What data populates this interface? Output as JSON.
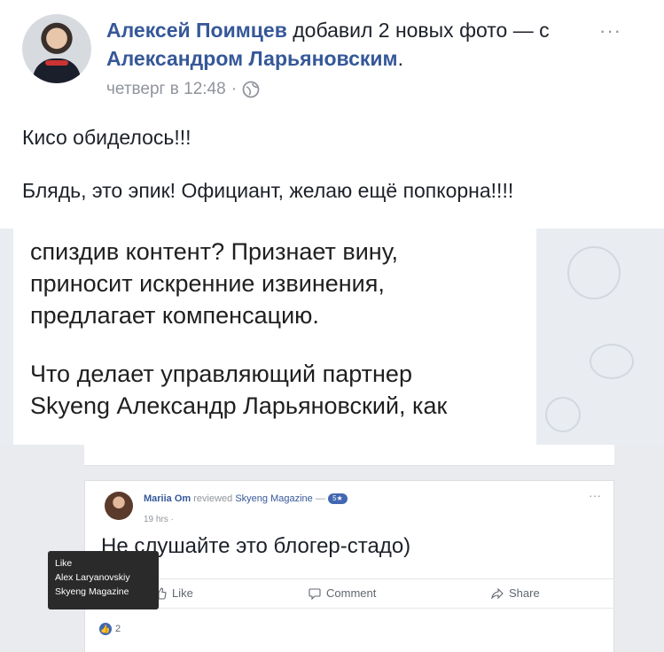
{
  "post": {
    "author": "Алексей Поимцев",
    "action_text": "добавил 2 новых фото — с",
    "tagged": "Александром Ларьяновским",
    "period": ".",
    "timestamp": "четверг в 12:48",
    "separator": "·",
    "menu": "···",
    "text_line1": "Кисо обиделось!!!",
    "text_line2": "Блядь, это эпик! Официант, желаю ещё попкорна!!!!"
  },
  "screenshot1": {
    "lines": [
      "спиздив контент? Признает вину,",
      "приносит искренние извинения,",
      "предлагает компенсацию.",
      "Что делает управляющий партнер",
      "Skyeng Александр Ларьяновский, как"
    ]
  },
  "screenshot2": {
    "author": "Mariia Om",
    "action": "reviewed",
    "page": "Skyeng Magazine",
    "dash": "—",
    "badge": "5★",
    "time": "19 hrs ·",
    "menu": "···",
    "comment": "Не слушайте это блогер-стадо)",
    "like_label": "Like",
    "comment_label": "Comment",
    "share_label": "Share",
    "likes_count": "2",
    "tooltip": {
      "title": "Like",
      "line1": "Alex Laryanovskiy",
      "line2": "Skyeng Magazine"
    }
  },
  "icons": [
    "globe-icon",
    "like-icon",
    "comment-icon",
    "share-icon",
    "more-icon"
  ],
  "colors": {
    "link": "#365899",
    "meta": "#90949c",
    "fb_blue": "#4267b2"
  }
}
